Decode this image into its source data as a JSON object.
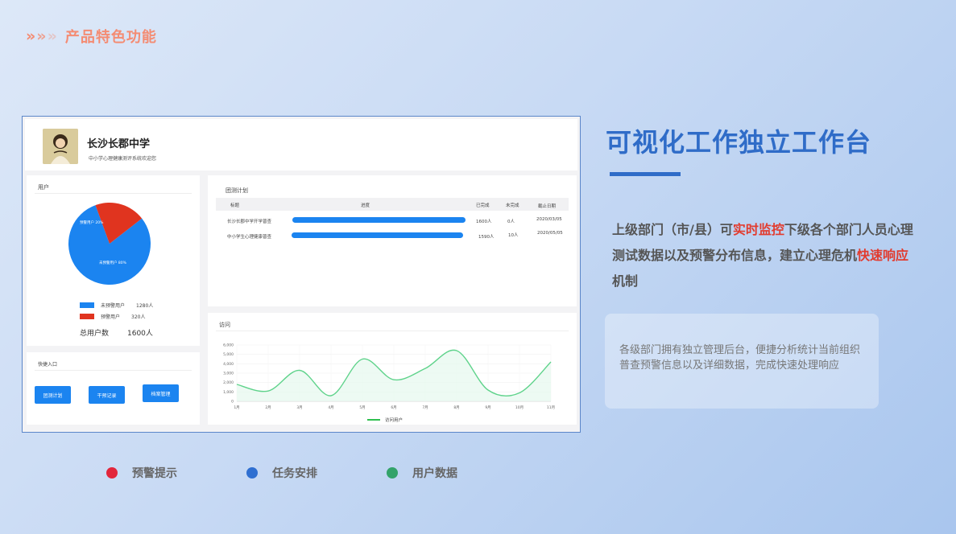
{
  "heading": {
    "arrows": [
      "»",
      "»",
      "»"
    ],
    "title": "产品特色功能"
  },
  "screenshot": {
    "school_name": "长沙长郡中学",
    "school_subtitle": "中小学心理健康测评系统欢迎您",
    "users_card": {
      "title": "用户",
      "pie_labels": {
        "warning": "预警用户 20%",
        "normal": "未预警用户 80%"
      },
      "legend": [
        {
          "label": "未预警用户",
          "count": "1280人",
          "color": "#1b84f0"
        },
        {
          "label": "预警用户",
          "count": "320人",
          "color": "#e0341f"
        }
      ],
      "total_label": "总用户数",
      "total_value": "1600人",
      "pie_values": [
        80,
        20
      ]
    },
    "quick_entry": {
      "title": "快捷入口",
      "buttons": [
        "团测计划",
        "干预记录",
        "档案管理"
      ]
    },
    "plan_card": {
      "title": "团测计划",
      "headers": [
        "标题",
        "进度",
        "已完成",
        "未完成",
        "截止日期"
      ],
      "rows": [
        {
          "title": "长沙长郡中学开学普查",
          "done": "1600人",
          "undone": "0人",
          "date": "2020/03/05",
          "progress": 1.0
        },
        {
          "title": "中小学生心理健康普查",
          "done": "1590人",
          "undone": "10人",
          "date": "2020/05/05",
          "progress": 0.99
        }
      ]
    },
    "visit_card": {
      "title": "访问",
      "legend": "访问用户"
    }
  },
  "chart_data": {
    "type": "line",
    "title": "访问",
    "x": [
      "1月",
      "2月",
      "3月",
      "4月",
      "5月",
      "6月",
      "7月",
      "8月",
      "9月",
      "10月",
      "11月"
    ],
    "series": [
      {
        "name": "访问用户",
        "values": [
          1800,
          1100,
          3300,
          600,
          4500,
          2300,
          3500,
          5400,
          1200,
          900,
          4200
        ]
      }
    ],
    "yticks": [
      "0",
      "1,000",
      "2,000",
      "3,000",
      "4,000",
      "5,000",
      "6,000"
    ],
    "ylim": [
      0,
      6000
    ],
    "xlabel": "",
    "ylabel": "",
    "grid": true,
    "legend": "bottom"
  },
  "right": {
    "title": "可视化工作独立工作台",
    "desc_parts": {
      "p1": "上级部门（市/县）可",
      "h1": "实时监控",
      "p2": "下级各个部门人员心理测试数据以及预警分布信息，建立心理危机",
      "h2": "快速响应",
      "p3": "机制"
    },
    "info": "各级部门拥有独立管理后台，便捷分析统计当前组织普查预警信息以及详细数据，完成快速处理响应"
  },
  "features": [
    {
      "label": "预警提示",
      "color": "#e2263b"
    },
    {
      "label": "任务安排",
      "color": "#2f6fd1"
    },
    {
      "label": "用户数据",
      "color": "#33a36a"
    }
  ],
  "colors": {
    "accent": "#2f6cc8",
    "highlight": "#e23b2e",
    "heading": "#f48c73",
    "line": "#5fd38b"
  }
}
